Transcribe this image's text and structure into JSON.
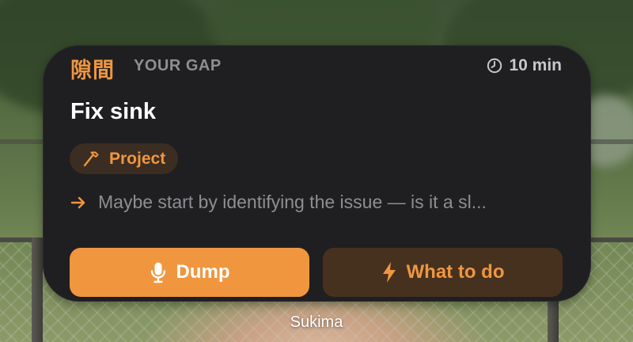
{
  "widget": {
    "kanji": "隙間",
    "header_label": "YOUR GAP",
    "time_icon": "clock-icon",
    "time_label": "10 min",
    "task_title": "Fix sink",
    "tag": {
      "icon": "hammer-icon",
      "label": "Project"
    },
    "hint": {
      "icon": "arrow-right-icon",
      "text": "Maybe start by identifying the issue — is it a sl..."
    },
    "buttons": {
      "dump": {
        "icon": "microphone-icon",
        "label": "Dump"
      },
      "what_to_do": {
        "icon": "lightning-bolt-icon",
        "label": "What to do"
      }
    }
  },
  "app_name": "Sukima",
  "colors": {
    "accent": "#f0963f",
    "card_bg": "#1f1f21",
    "tag_bg": "#3b2d22",
    "secondary_button_bg": "#46311f",
    "muted_text": "#8e8e93"
  }
}
